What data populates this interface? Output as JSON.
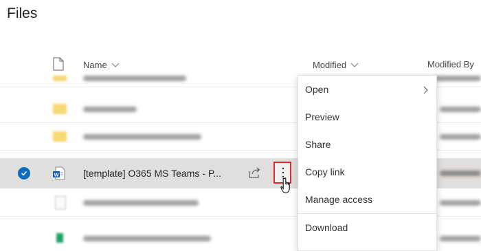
{
  "page": {
    "title": "Files"
  },
  "header": {
    "columns": [
      {
        "label": "Name"
      },
      {
        "label": "Modified"
      },
      {
        "label": "Modified By"
      }
    ]
  },
  "selected_file": {
    "name": "[template] O365 MS Teams - P..."
  },
  "context_menu": {
    "items": [
      {
        "label": "Open",
        "has_submenu": true
      },
      {
        "label": "Preview"
      },
      {
        "label": "Share"
      },
      {
        "label": "Copy link"
      },
      {
        "label": "Manage access"
      },
      {
        "label": "Download"
      }
    ]
  },
  "colors": {
    "accent": "#0f6cbd",
    "selected_row": "#e1dfdd",
    "highlight_border": "#e0282e",
    "word_icon": "#185abd"
  }
}
